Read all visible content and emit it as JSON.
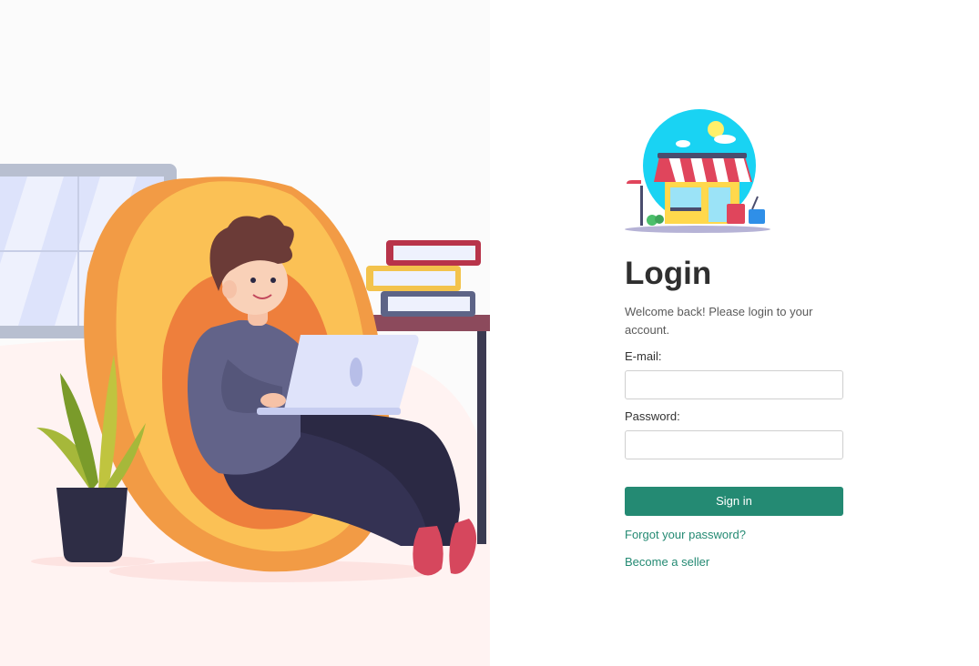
{
  "login": {
    "title": "Login",
    "welcome": "Welcome back! Please login to your account.",
    "email_label": "E-mail:",
    "email_value": "",
    "password_label": "Password:",
    "password_value": "",
    "signin_label": "Sign in",
    "forgot_label": "Forgot your password?",
    "seller_label": "Become a seller"
  },
  "colors": {
    "accent": "#248a73",
    "title": "#2f2f2f",
    "left_bg": "#fbfbfb"
  },
  "icons": {
    "logo": "store-logo-icon",
    "illustration": "person-with-laptop-illustration"
  }
}
